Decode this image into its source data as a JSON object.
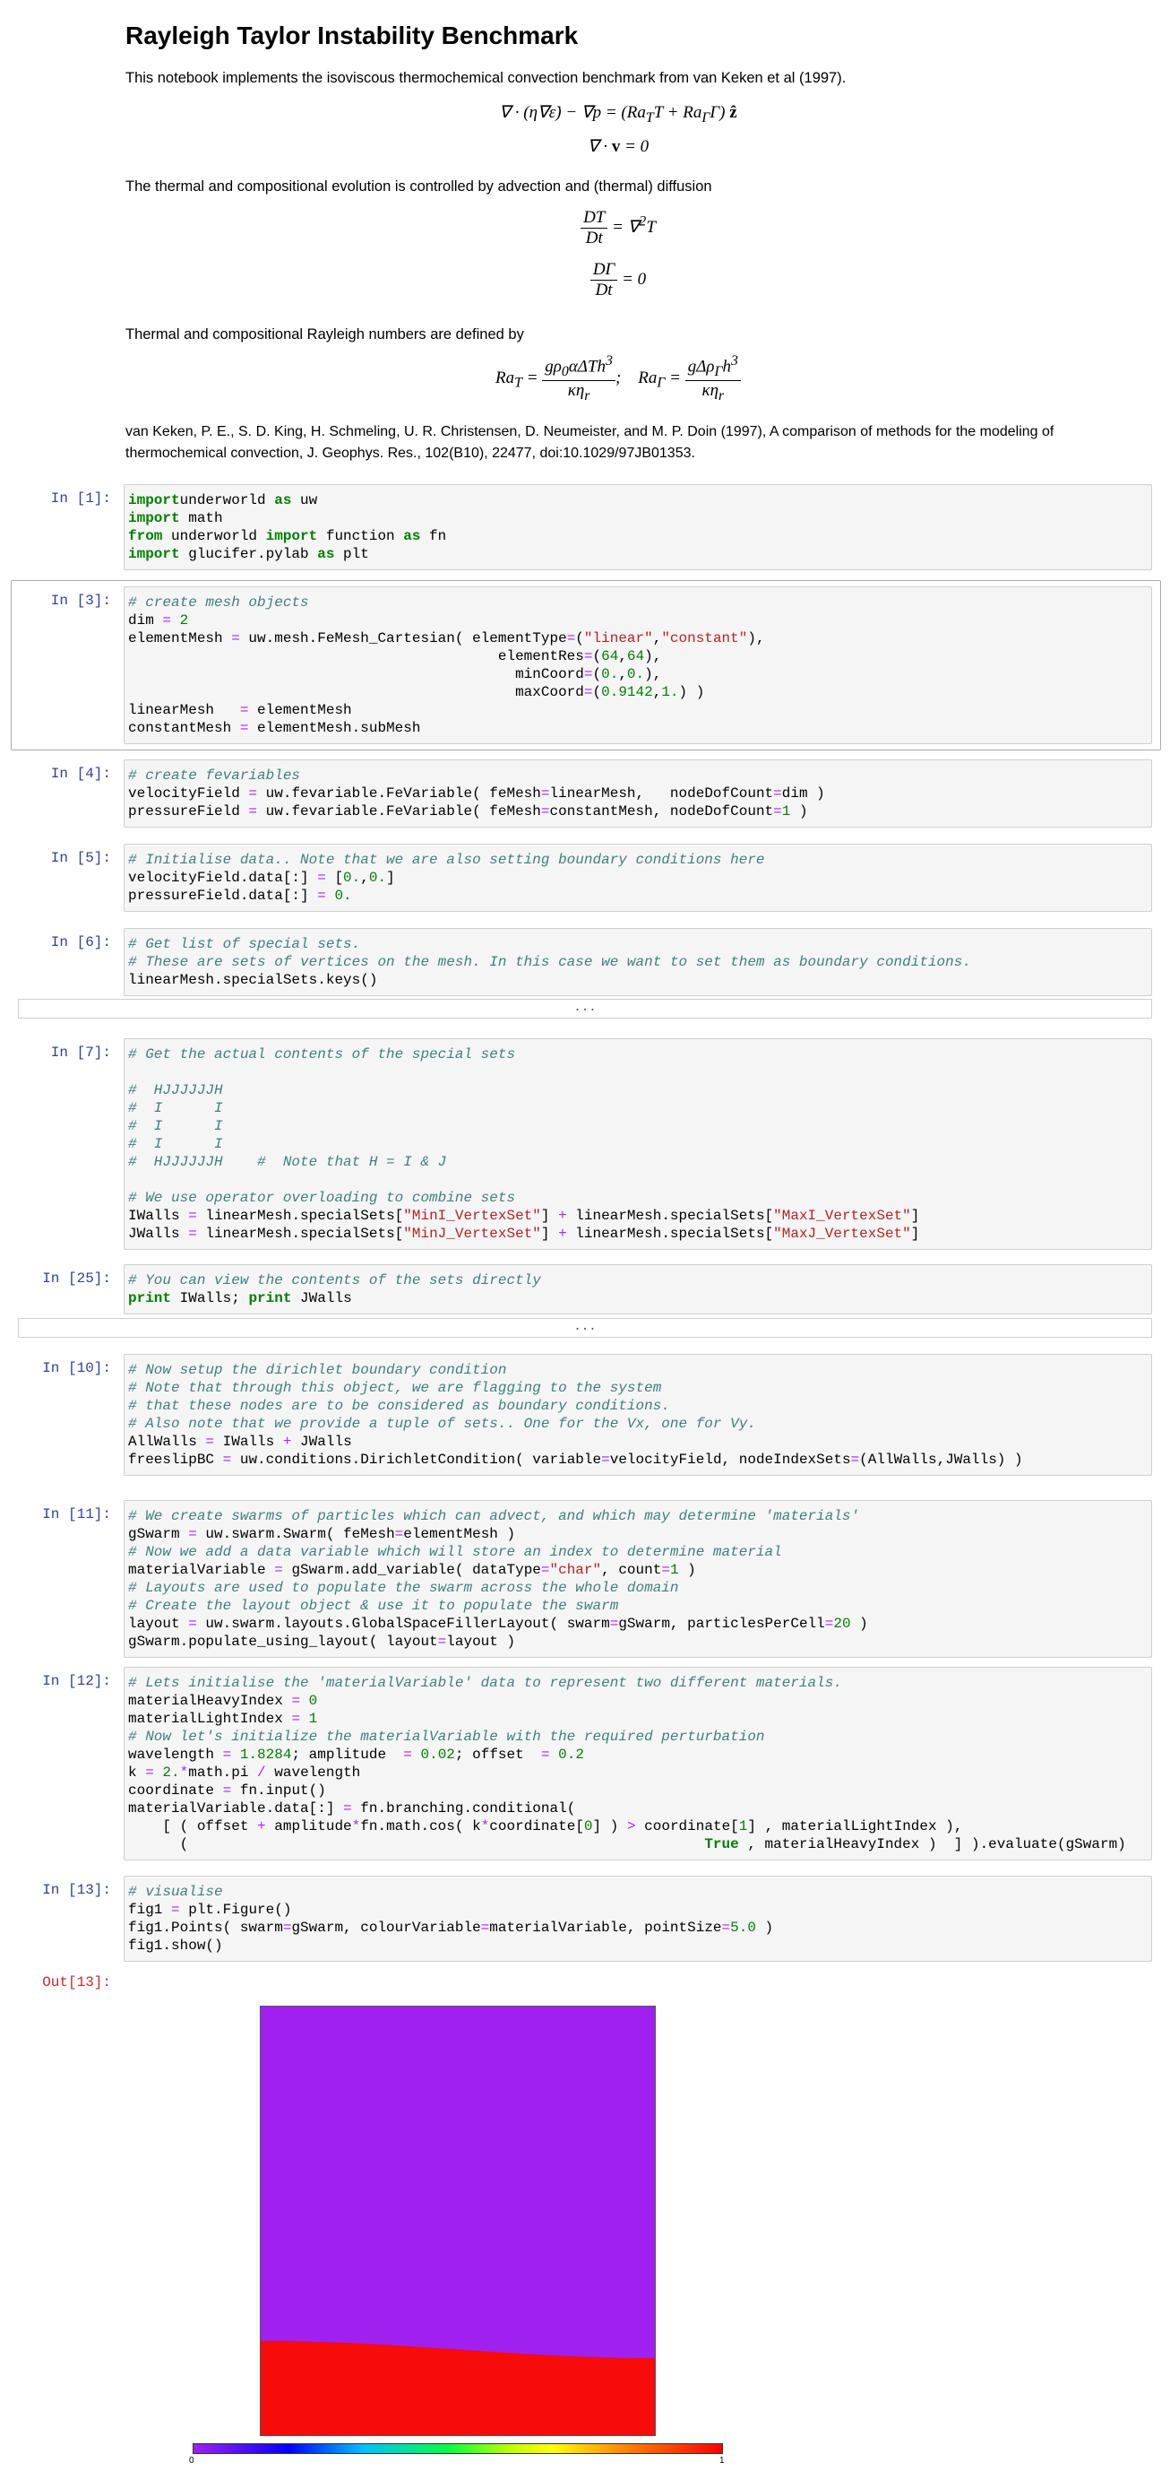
{
  "intro": {
    "title": "Rayleigh Taylor Instability Benchmark",
    "p1": "This notebook implements the isoviscous thermochemical convection benchmark from van Keken et al (1997).",
    "p2": "The thermal and compositional evolution is controlled by advection and (thermal) diffusion",
    "p3": "Thermal and compositional Rayleigh numbers are defined by",
    "reference": "van Keken, P. E., S. D. King, H. Schmeling, U. R. Christensen, D. Neumeister, and M. P. Doin (1997), A comparison of methods for the modeling of thermochemical convection, J. Geophys. Res., 102(B10), 22477, doi:10.1029/97JB01353."
  },
  "cells": [
    {
      "prompt": "In [1]:",
      "lines": [
        [
          [
            "kw",
            "import"
          ],
          [
            "",
            "underworld "
          ],
          [
            "kw",
            "as"
          ],
          [
            "",
            " uw"
          ]
        ],
        [
          [
            "kw",
            "import"
          ],
          [
            "",
            " math"
          ]
        ],
        [
          [
            "kw",
            "from"
          ],
          [
            "",
            " underworld "
          ],
          [
            "kw",
            "import"
          ],
          [
            "",
            " function "
          ],
          [
            "kw",
            "as"
          ],
          [
            "",
            " fn"
          ]
        ],
        [
          [
            "kw",
            "import"
          ],
          [
            "",
            " glucifer.pylab "
          ],
          [
            "kw",
            "as"
          ],
          [
            "",
            " plt"
          ]
        ]
      ]
    },
    {
      "prompt": "In [3]:",
      "selected": true,
      "lines": [
        [
          [
            "cm",
            "# create mesh objects"
          ]
        ],
        [
          [
            "",
            "dim "
          ],
          [
            "op",
            "="
          ],
          [
            "",
            " "
          ],
          [
            "nu",
            "2"
          ]
        ],
        [
          [
            "",
            "elementMesh "
          ],
          [
            "op",
            "="
          ],
          [
            "",
            " uw.mesh.FeMesh_Cartesian( elementType"
          ],
          [
            "op",
            "="
          ],
          [
            "",
            "("
          ],
          [
            "st",
            "\"linear\""
          ],
          [
            "",
            ","
          ],
          [
            "st",
            "\"constant\""
          ],
          [
            "",
            "),"
          ]
        ],
        [
          [
            "",
            "                                           elementRes"
          ],
          [
            "op",
            "="
          ],
          [
            "",
            "("
          ],
          [
            "nu",
            "64"
          ],
          [
            "",
            ","
          ],
          [
            "nu",
            "64"
          ],
          [
            "",
            "),"
          ]
        ],
        [
          [
            "",
            "                                             minCoord"
          ],
          [
            "op",
            "="
          ],
          [
            "",
            "("
          ],
          [
            "nu",
            "0."
          ],
          [
            "",
            ","
          ],
          [
            "nu",
            "0."
          ],
          [
            "",
            "),"
          ]
        ],
        [
          [
            "",
            "                                             maxCoord"
          ],
          [
            "op",
            "="
          ],
          [
            "",
            "("
          ],
          [
            "nu",
            "0.9142"
          ],
          [
            "",
            ","
          ],
          [
            "nu",
            "1."
          ],
          [
            "",
            ") )"
          ]
        ],
        [
          [
            "",
            "linearMesh   "
          ],
          [
            "op",
            "="
          ],
          [
            "",
            " elementMesh"
          ]
        ],
        [
          [
            "",
            "constantMesh "
          ],
          [
            "op",
            "="
          ],
          [
            "",
            " elementMesh.subMesh"
          ]
        ]
      ]
    },
    {
      "prompt": "In [4]:",
      "lines": [
        [
          [
            "cm",
            "# create fevariables"
          ]
        ],
        [
          [
            "",
            "velocityField "
          ],
          [
            "op",
            "="
          ],
          [
            "",
            " uw.fevariable.FeVariable( feMesh"
          ],
          [
            "op",
            "="
          ],
          [
            "",
            "linearMesh,   nodeDofCount"
          ],
          [
            "op",
            "="
          ],
          [
            "",
            "dim )"
          ]
        ],
        [
          [
            "",
            "pressureField "
          ],
          [
            "op",
            "="
          ],
          [
            "",
            " uw.fevariable.FeVariable( feMesh"
          ],
          [
            "op",
            "="
          ],
          [
            "",
            "constantMesh, nodeDofCount"
          ],
          [
            "op",
            "="
          ],
          [
            "nu",
            "1"
          ],
          [
            "",
            " )"
          ]
        ]
      ]
    },
    {
      "prompt": "In [5]:",
      "lines": [
        [
          [
            "cm",
            "# Initialise data.. Note that we are also setting boundary conditions here"
          ]
        ],
        [
          [
            "",
            "velocityField.data[:] "
          ],
          [
            "op",
            "="
          ],
          [
            "",
            " ["
          ],
          [
            "nu",
            "0."
          ],
          [
            "",
            ","
          ],
          [
            "nu",
            "0."
          ],
          [
            "",
            "]"
          ]
        ],
        [
          [
            "",
            "pressureField.data[:] "
          ],
          [
            "op",
            "="
          ],
          [
            "",
            " "
          ],
          [
            "nu",
            "0."
          ]
        ]
      ]
    },
    {
      "prompt": "In [6]:",
      "collapsed": "...",
      "lines": [
        [
          [
            "cm",
            "# Get list of special sets."
          ]
        ],
        [
          [
            "cm",
            "# These are sets of vertices on the mesh. In this case we want to set them as boundary conditions."
          ]
        ],
        [
          [
            "",
            "linearMesh.specialSets.keys()"
          ]
        ]
      ]
    },
    {
      "prompt": "In [7]:",
      "lines": [
        [
          [
            "cm",
            "# Get the actual contents of the special sets"
          ]
        ],
        [
          [
            "",
            ""
          ]
        ],
        [
          [
            "cm",
            "#  HJJJJJJH"
          ]
        ],
        [
          [
            "cm",
            "#  I      I"
          ]
        ],
        [
          [
            "cm",
            "#  I      I"
          ]
        ],
        [
          [
            "cm",
            "#  I      I"
          ]
        ],
        [
          [
            "cm",
            "#  HJJJJJJH    #  Note that H = I & J"
          ]
        ],
        [
          [
            "",
            ""
          ]
        ],
        [
          [
            "cm",
            "# We use operator overloading to combine sets"
          ]
        ],
        [
          [
            "",
            "IWalls "
          ],
          [
            "op",
            "="
          ],
          [
            "",
            " linearMesh.specialSets["
          ],
          [
            "st",
            "\"MinI_VertexSet\""
          ],
          [
            "",
            "] "
          ],
          [
            "op",
            "+"
          ],
          [
            "",
            " linearMesh.specialSets["
          ],
          [
            "st",
            "\"MaxI_VertexSet\""
          ],
          [
            "",
            "]"
          ]
        ],
        [
          [
            "",
            "JWalls "
          ],
          [
            "op",
            "="
          ],
          [
            "",
            " linearMesh.specialSets["
          ],
          [
            "st",
            "\"MinJ_VertexSet\""
          ],
          [
            "",
            "] "
          ],
          [
            "op",
            "+"
          ],
          [
            "",
            " linearMesh.specialSets["
          ],
          [
            "st",
            "\"MaxJ_VertexSet\""
          ],
          [
            "",
            "]"
          ]
        ]
      ]
    },
    {
      "prompt": "In [25]:",
      "collapsed": "...",
      "lines": [
        [
          [
            "cm",
            "# You can view the contents of the sets directly"
          ]
        ],
        [
          [
            "kw",
            "print"
          ],
          [
            "",
            " IWalls; "
          ],
          [
            "kw",
            "print"
          ],
          [
            "",
            " JWalls"
          ]
        ]
      ]
    },
    {
      "prompt": "In [10]:",
      "lines": [
        [
          [
            "cm",
            "# Now setup the dirichlet boundary condition"
          ]
        ],
        [
          [
            "cm",
            "# Note that through this object, we are flagging to the system"
          ]
        ],
        [
          [
            "cm",
            "# that these nodes are to be considered as boundary conditions."
          ]
        ],
        [
          [
            "cm",
            "# Also note that we provide a tuple of sets.. One for the Vx, one for Vy."
          ]
        ],
        [
          [
            "",
            "AllWalls "
          ],
          [
            "op",
            "="
          ],
          [
            "",
            " IWalls "
          ],
          [
            "op",
            "+"
          ],
          [
            "",
            " JWalls"
          ]
        ],
        [
          [
            "",
            "freeslipBC "
          ],
          [
            "op",
            "="
          ],
          [
            "",
            " uw.conditions.DirichletCondition( variable"
          ],
          [
            "op",
            "="
          ],
          [
            "",
            "velocityField, nodeIndexSets"
          ],
          [
            "op",
            "="
          ],
          [
            "",
            "(AllWalls,JWalls) )"
          ]
        ]
      ]
    },
    {
      "prompt": "In [11]:",
      "lines": [
        [
          [
            "cm",
            "# We create swarms of particles which can advect, and which may determine 'materials'"
          ]
        ],
        [
          [
            "",
            "gSwarm "
          ],
          [
            "op",
            "="
          ],
          [
            "",
            " uw.swarm.Swarm( feMesh"
          ],
          [
            "op",
            "="
          ],
          [
            "",
            "elementMesh )"
          ]
        ],
        [
          [
            "cm",
            "# Now we add a data variable which will store an index to determine material"
          ]
        ],
        [
          [
            "",
            "materialVariable "
          ],
          [
            "op",
            "="
          ],
          [
            "",
            " gSwarm.add_variable( dataType"
          ],
          [
            "op",
            "="
          ],
          [
            "st",
            "\"char\""
          ],
          [
            "",
            ", count"
          ],
          [
            "op",
            "="
          ],
          [
            "nu",
            "1"
          ],
          [
            "",
            " )"
          ]
        ],
        [
          [
            "cm",
            "# Layouts are used to populate the swarm across the whole domain"
          ]
        ],
        [
          [
            "cm",
            "# Create the layout object & use it to populate the swarm"
          ]
        ],
        [
          [
            "",
            "layout "
          ],
          [
            "op",
            "="
          ],
          [
            "",
            " uw.swarm.layouts.GlobalSpaceFillerLayout( swarm"
          ],
          [
            "op",
            "="
          ],
          [
            "",
            "gSwarm, particlesPerCell"
          ],
          [
            "op",
            "="
          ],
          [
            "nu",
            "20"
          ],
          [
            "",
            " )"
          ]
        ],
        [
          [
            "",
            "gSwarm.populate_using_layout( layout"
          ],
          [
            "op",
            "="
          ],
          [
            "",
            "layout )"
          ]
        ]
      ]
    },
    {
      "prompt": "In [12]:",
      "lines": [
        [
          [
            "cm",
            "# Lets initialise the 'materialVariable' data to represent two different materials."
          ]
        ],
        [
          [
            "",
            "materialHeavyIndex "
          ],
          [
            "op",
            "="
          ],
          [
            "",
            " "
          ],
          [
            "nu",
            "0"
          ]
        ],
        [
          [
            "",
            "materialLightIndex "
          ],
          [
            "op",
            "="
          ],
          [
            "",
            " "
          ],
          [
            "nu",
            "1"
          ]
        ],
        [
          [
            "cm",
            "# Now let's initialize the materialVariable with the required perturbation"
          ]
        ],
        [
          [
            "",
            "wavelength "
          ],
          [
            "op",
            "="
          ],
          [
            "",
            " "
          ],
          [
            "nu",
            "1.8284"
          ],
          [
            "",
            "; amplitude  "
          ],
          [
            "op",
            "="
          ],
          [
            "",
            " "
          ],
          [
            "nu",
            "0.02"
          ],
          [
            "",
            "; offset  "
          ],
          [
            "op",
            "="
          ],
          [
            "",
            " "
          ],
          [
            "nu",
            "0.2"
          ]
        ],
        [
          [
            "",
            "k "
          ],
          [
            "op",
            "="
          ],
          [
            "",
            " "
          ],
          [
            "nu",
            "2."
          ],
          [
            "op",
            "*"
          ],
          [
            "",
            "math.pi "
          ],
          [
            "op",
            "/"
          ],
          [
            "",
            " wavelength"
          ]
        ],
        [
          [
            "",
            "coordinate "
          ],
          [
            "op",
            "="
          ],
          [
            "",
            " fn.input()"
          ]
        ],
        [
          [
            "",
            "materialVariable.data[:] "
          ],
          [
            "op",
            "="
          ],
          [
            "",
            " fn.branching.conditional("
          ]
        ],
        [
          [
            "",
            "    [ ( offset "
          ],
          [
            "op",
            "+"
          ],
          [
            "",
            " amplitude"
          ],
          [
            "op",
            "*"
          ],
          [
            "",
            "fn.math.cos( k"
          ],
          [
            "op",
            "*"
          ],
          [
            "",
            "coordinate["
          ],
          [
            "nu",
            "0"
          ],
          [
            "",
            "] ) "
          ],
          [
            "op",
            ">"
          ],
          [
            "",
            " coordinate["
          ],
          [
            "nu",
            "1"
          ],
          [
            "",
            "] , materialLightIndex ),"
          ]
        ],
        [
          [
            "",
            "      (                                                            "
          ],
          [
            "kw",
            "True"
          ],
          [
            "",
            " , materialHeavyIndex )  ] ).evaluate(gSwarm)"
          ]
        ]
      ]
    },
    {
      "prompt": "In [13]:",
      "lines": [
        [
          [
            "cm",
            "# visualise"
          ]
        ],
        [
          [
            "",
            "fig1 "
          ],
          [
            "op",
            "="
          ],
          [
            "",
            " plt.Figure()"
          ]
        ],
        [
          [
            "",
            "fig1.Points( swarm"
          ],
          [
            "op",
            "="
          ],
          [
            "",
            "gSwarm, colourVariable"
          ],
          [
            "op",
            "="
          ],
          [
            "",
            "materialVariable, pointSize"
          ],
          [
            "op",
            "="
          ],
          [
            "nu",
            "5.0"
          ],
          [
            "",
            " )"
          ]
        ],
        [
          [
            "",
            "fig1.show()"
          ]
        ]
      ]
    }
  ],
  "output": {
    "prompt": "Out[13]:",
    "colors": {
      "light": "#A020F0",
      "heavy": "#F70B0B"
    },
    "wavelength": 1.8284,
    "amplitude": 0.02,
    "offset": 0.2,
    "xmax": 0.9142,
    "colorbar": {
      "min": "0",
      "max": "1"
    }
  }
}
